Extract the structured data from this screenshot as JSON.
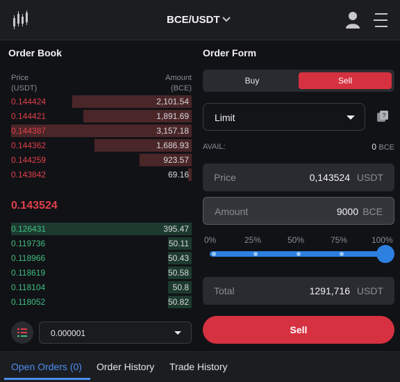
{
  "header": {
    "logo_icon": "candlestick-chart-icon",
    "pair": "BCE/USDT",
    "user_icon": "user-icon",
    "menu_icon": "menu-icon"
  },
  "order_book": {
    "title": "Order Book",
    "price_header": [
      "Price",
      "(USDT)"
    ],
    "amount_header": [
      "Amount",
      "(BCE)"
    ],
    "asks": [
      {
        "price": "0.144424",
        "amount": "2,101.54",
        "depth": 0.66
      },
      {
        "price": "0.144421",
        "amount": "1,891.69",
        "depth": 0.6
      },
      {
        "price": "0.144387",
        "amount": "3,157.18",
        "depth": 1.0
      },
      {
        "price": "0.144362",
        "amount": "1,686.93",
        "depth": 0.54
      },
      {
        "price": "0.144259",
        "amount": "923.57",
        "depth": 0.29
      },
      {
        "price": "0.143842",
        "amount": "69.16",
        "depth": 0.02
      }
    ],
    "last_price": "0.143524",
    "bids": [
      {
        "price": "0.126431",
        "amount": "395.47",
        "depth": 1.0
      },
      {
        "price": "0.119736",
        "amount": "50.11",
        "depth": 0.13
      },
      {
        "price": "0.118966",
        "amount": "50.43",
        "depth": 0.13
      },
      {
        "price": "0.118619",
        "amount": "50.58",
        "depth": 0.13
      },
      {
        "price": "0.118104",
        "amount": "50.8",
        "depth": 0.13
      },
      {
        "price": "0.118052",
        "amount": "50.82",
        "depth": 0.13
      }
    ],
    "depth_icon": "list-icon",
    "precision": "0.000001"
  },
  "order_form": {
    "title": "Order Form",
    "buy_label": "Buy",
    "sell_tab_label": "Sell",
    "order_type": "Limit",
    "calculator_icon": "calculator-icon",
    "avail_label": "AVAIL:",
    "avail_value": "0",
    "avail_unit": "BCE",
    "price_label": "Price",
    "price_value": "0,143524",
    "price_unit": "USDT",
    "amount_label": "Amount",
    "amount_value": "9000",
    "amount_unit": "BCE",
    "percent_marks": [
      "0%",
      "25%",
      "50%",
      "75%",
      "100%"
    ],
    "slider_percent": 100,
    "total_label": "Total",
    "total_value": "1291,716",
    "total_unit": "USDT",
    "submit_label": "Sell"
  },
  "bottom_tabs": {
    "open_orders": "Open Orders (0)",
    "order_history": "Order History",
    "trade_history": "Trade History"
  },
  "colors": {
    "sell": "#d63140",
    "ask": "#e0404a",
    "bid": "#3fbf7f",
    "accent": "#4b8ef0"
  }
}
